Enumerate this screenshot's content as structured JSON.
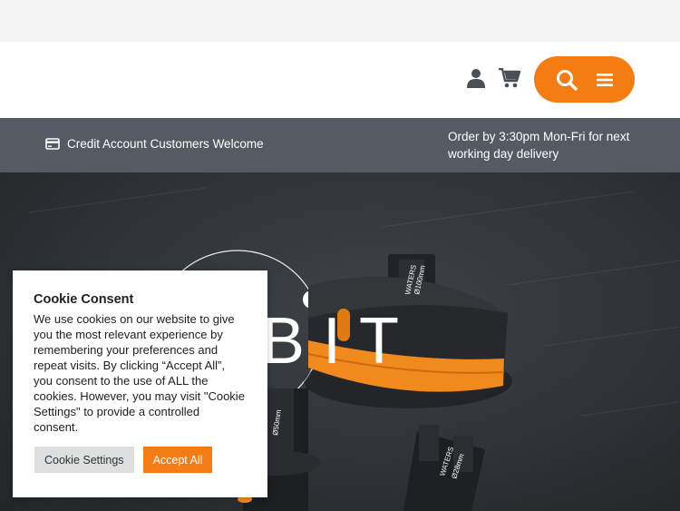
{
  "header": {
    "account_icon": "user-icon",
    "cart_icon": "cart-icon",
    "search_icon": "search-icon",
    "menu_icon": "hamburger-menu-icon",
    "accent_color": "#f57c13"
  },
  "infobar": {
    "credit_icon": "credit-card-icon",
    "credit_text": "Credit Account Customers Welcome",
    "delivery_text": "Order by 3:30pm Mon-Fri for next working day delivery"
  },
  "hero": {
    "title_fragment": "BIT",
    "product_labels": [
      "WATERS",
      "Ø100mm",
      "Ø50mm",
      "WATERS",
      "Ø28mm"
    ]
  },
  "cookie": {
    "title": "Cookie Consent",
    "body": "We use cookies on our website to give you the most relevant experience by remembering your preferences and repeat visits. By clicking “Accept All”, you consent to the use of ALL the cookies. However, you may visit \"Cookie Settings\" to provide a controlled consent.",
    "settings_label": "Cookie Settings",
    "accept_label": "Accept All"
  }
}
